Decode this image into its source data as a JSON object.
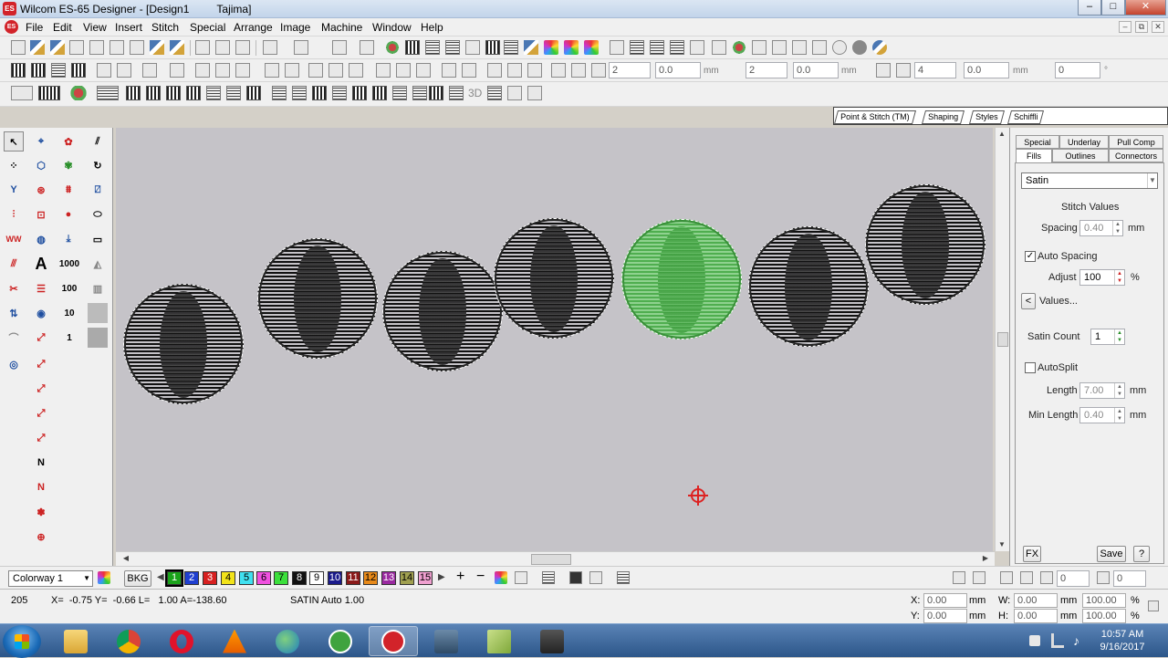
{
  "window": {
    "title": "Wilcom ES-65 Designer - [Design1",
    "machine": "Tajima]",
    "minimize": "–",
    "maximize": "□",
    "close": "✕"
  },
  "menu": [
    "File",
    "Edit",
    "View",
    "Insert",
    "Stitch",
    "Special",
    "Arrange",
    "Image",
    "Machine",
    "Window",
    "Help"
  ],
  "mdi_controls": [
    "–",
    "⧉",
    "✕"
  ],
  "toolbar2": {
    "spin1": "2",
    "spin1_val": "0.0",
    "unit1": "mm",
    "spin2": "2",
    "spin2_val": "0.0",
    "unit2": "mm",
    "spin3": "4",
    "spin3_val": "0.0",
    "unit3": "mm",
    "spin4": "0",
    "unit4": "°"
  },
  "toolbar3": {
    "label_3d": "3D"
  },
  "tabs": [
    "Point & Stitch (TM)",
    "Shaping",
    "Styles",
    "Schiffli"
  ],
  "left_tools": {
    "count_1000a": "1000",
    "count_100": "100",
    "count_1000b": "1000",
    "count_100b": "100",
    "count_10": "10",
    "count_1": "1"
  },
  "panel": {
    "tabs_top": [
      "Special",
      "Underlay",
      "Pull Comp"
    ],
    "tabs_bottom": [
      "Fills",
      "Outlines",
      "Connectors"
    ],
    "fill_type": "Satin",
    "section": "Stitch Values",
    "spacing_label": "Spacing",
    "spacing_value": "0.40",
    "spacing_unit": "mm",
    "auto_spacing_label": "Auto Spacing",
    "auto_spacing_checked": "✓",
    "adjust_label": "Adjust",
    "adjust_value": "100",
    "adjust_unit": "%",
    "values_btn": "Values...",
    "values_arrow": "<",
    "satin_count_label": "Satin Count",
    "satin_count_value": "1",
    "autosplit_label": "AutoSplit",
    "length_label": "Length",
    "length_value": "7.00",
    "length_unit": "mm",
    "minlength_label": "Min Length",
    "minlength_value": "0.40",
    "minlength_unit": "mm",
    "fx_btn": "FX",
    "save_btn": "Save",
    "help_btn": "?"
  },
  "colorway": {
    "selected": "Colorway 1",
    "bkg": "BKG",
    "swatches": [
      {
        "n": "1",
        "c": "#1aa31a",
        "t": "#fff"
      },
      {
        "n": "2",
        "c": "#1f3fd0",
        "t": "#fff"
      },
      {
        "n": "3",
        "c": "#d71f1f",
        "t": "#fff"
      },
      {
        "n": "4",
        "c": "#f2e31a",
        "t": "#000"
      },
      {
        "n": "5",
        "c": "#3fe0f0",
        "t": "#000"
      },
      {
        "n": "6",
        "c": "#f050e0",
        "t": "#000"
      },
      {
        "n": "7",
        "c": "#3ce03c",
        "t": "#000"
      },
      {
        "n": "8",
        "c": "#111111",
        "t": "#fff"
      },
      {
        "n": "9",
        "c": "#ffffff",
        "t": "#000"
      },
      {
        "n": "10",
        "c": "#1a1a8a",
        "t": "#fff"
      },
      {
        "n": "11",
        "c": "#8a1a1a",
        "t": "#fff"
      },
      {
        "n": "12",
        "c": "#e88a1a",
        "t": "#000"
      },
      {
        "n": "13",
        "c": "#9a2aa0",
        "t": "#fff"
      },
      {
        "n": "14",
        "c": "#a0a050",
        "t": "#000"
      },
      {
        "n": "15",
        "c": "#f0a0d0",
        "t": "#000"
      }
    ],
    "angle1": "0",
    "angle2": "0"
  },
  "status": {
    "count": "205",
    "coords": "X=  -0.75 Y=  -0.66 L=   1.00 A=-138.60",
    "info": "SATIN Auto  1.00",
    "x_label": "X:",
    "x_val": "0.00",
    "y_label": "Y:",
    "y_val": "0.00",
    "w_label": "W:",
    "w_val": "0.00",
    "h_label": "H:",
    "h_val": "0.00",
    "unit": "mm",
    "pct1": "100.00",
    "pct2": "100.00",
    "pct": "%"
  },
  "taskbar": {
    "time": "10:57 AM",
    "date": "9/16/2017"
  },
  "colors": {
    "accent_green": "#4fae4f",
    "canvas": "#c5c3c8",
    "crosshair": "#d22"
  }
}
